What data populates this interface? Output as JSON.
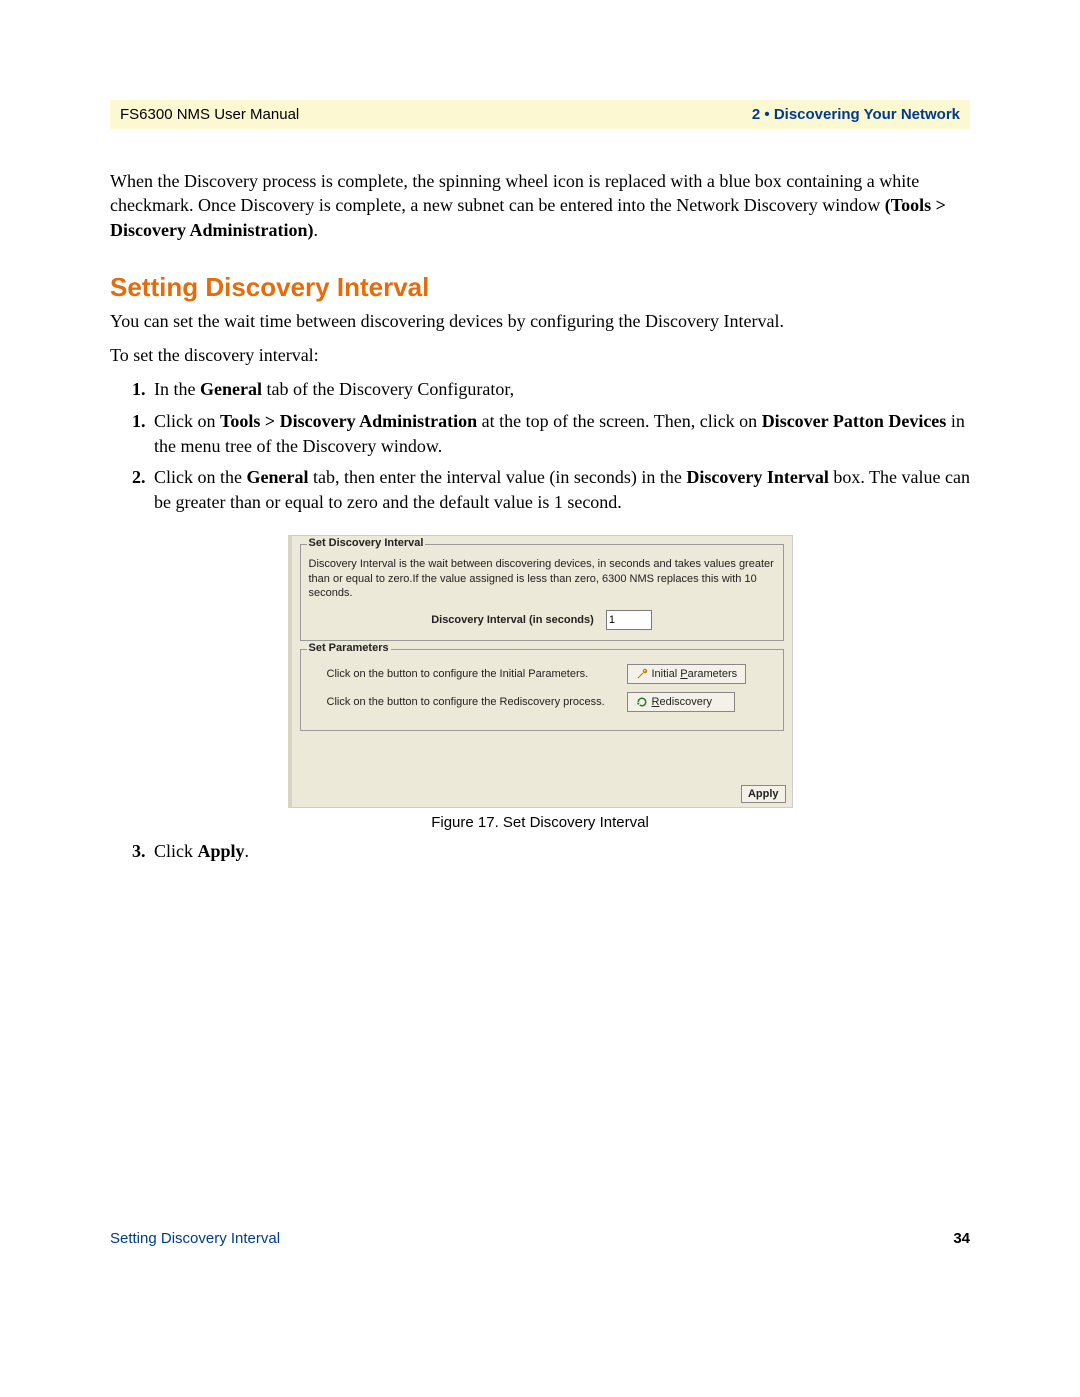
{
  "header": {
    "left": "FS6300 NMS User Manual",
    "right": "2 • Discovering Your Network"
  },
  "intro_para": {
    "pre": "When the Discovery process is complete, the spinning wheel icon is replaced with a blue box containing a white checkmark. Once Discovery is complete, a new subnet can be entered into the Network Discovery window ",
    "bold": "(Tools > Discovery Administration)",
    "post": "."
  },
  "section_heading": "Setting Discovery Interval",
  "section_intro": "You can set the wait time between discovering devices by configuring the Discovery Interval.",
  "section_lead": "To set the discovery interval:",
  "steps": {
    "s1": {
      "pre": "In the ",
      "b1": "General",
      "post": " tab of the Discovery Configurator,"
    },
    "s1b": {
      "pre": "Click on ",
      "b1": "Tools > Discovery Administration",
      "mid": " at the top of the screen. Then, click on ",
      "b2": "Discover Patton Devices",
      "post": " in the menu tree of the Discovery window."
    },
    "s2": {
      "pre": "Click on the ",
      "b1": "General",
      "mid1": " tab, then enter the interval value (in seconds) in the ",
      "b2": "Discovery Interval",
      "mid2": " box. ",
      "post": "The value can be greater than or equal to zero and the default value is 1 second."
    },
    "s3": {
      "pre": "Click ",
      "b1": "Apply",
      "post": "."
    }
  },
  "figure": {
    "set_interval_legend": "Set Discovery Interval",
    "set_interval_info": "Discovery Interval is the wait between discovering devices, in seconds and takes values greater than or equal to zero.If the value assigned is less than zero, 6300 NMS replaces this with 10 seconds.",
    "interval_label": "Discovery Interval (in seconds)",
    "interval_value": "1",
    "set_params_legend": "Set Parameters",
    "params_row1_label": "Click on the button to configure the Initial Parameters.",
    "params_row1_button_pre": "Initial ",
    "params_row1_button_u": "P",
    "params_row1_button_post": "arameters",
    "params_row2_label": "Click on the button to configure the Rediscovery process.",
    "params_row2_button_u": "R",
    "params_row2_button_post": "ediscovery",
    "apply_button": "Apply",
    "caption": "Figure 17. Set Discovery Interval"
  },
  "footer": {
    "left": "Setting Discovery Interval",
    "right": "34"
  }
}
